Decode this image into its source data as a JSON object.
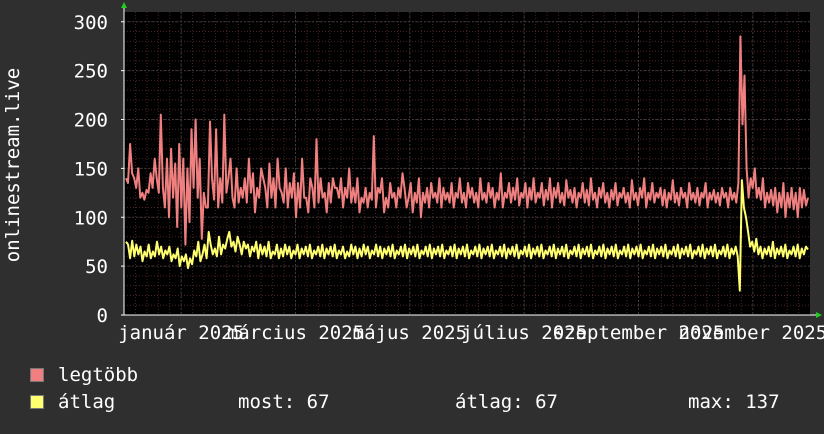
{
  "colors": {
    "background": "#2f2f2f",
    "plot_background": "#000000",
    "grid": "#3a3a3a",
    "grid_minor": "#4a2222",
    "axis": "#ffffff",
    "arrow": "#22cc22",
    "legtobb": "#f08080",
    "atlag": "#ffff70"
  },
  "legend": {
    "legtobb_label": "legtöbb",
    "atlag_label": "átlag",
    "stats": {
      "most_label": "most:",
      "most_value": "67",
      "atlag_label": "átlag:",
      "atlag_value": "67",
      "max_label": "max:",
      "max_value": "137"
    }
  },
  "chart_data": {
    "type": "line",
    "ylabel": "onlinestream.live",
    "ylim": [
      0,
      310
    ],
    "yticks": [
      0,
      50,
      100,
      150,
      200,
      250,
      300
    ],
    "x_tick_labels": [
      "január 2025",
      "március 2025",
      "május 2025",
      "július 2025",
      "szeptember 2025",
      "november 2025"
    ],
    "grid": true,
    "series": [
      {
        "name": "legtöbb",
        "color": "#f08080",
        "values": [
          140,
          135,
          175,
          145,
          140,
          130,
          150,
          120,
          125,
          118,
          128,
          125,
          145,
          130,
          160,
          140,
          125,
          205,
          130,
          110,
          160,
          100,
          170,
          120,
          155,
          90,
          175,
          110,
          160,
          72,
          150,
          95,
          190,
          130,
          200,
          120,
          160,
          78,
          125,
          110,
          110,
          198,
          140,
          118,
          190,
          110,
          140,
          115,
          205,
          125,
          140,
          160,
          120,
          110,
          150,
          115,
          130,
          120,
          140,
          115,
          160,
          125,
          145,
          105,
          130,
          120,
          150,
          140,
          130,
          110,
          155,
          120,
          140,
          110,
          160,
          130,
          125,
          115,
          150,
          110,
          135,
          120,
          145,
          100,
          135,
          110,
          160,
          120,
          120,
          105,
          140,
          130,
          110,
          180,
          115,
          140,
          120,
          125,
          105,
          135,
          115,
          140,
          130,
          130,
          120,
          140,
          110,
          130,
          120,
          150,
          115,
          130,
          115,
          140,
          105,
          120,
          115,
          130,
          110,
          125,
          118,
          183,
          110,
          130,
          125,
          140,
          105,
          120,
          110,
          135,
          120,
          125,
          110,
          130,
          120,
          145,
          130,
          110,
          120,
          135,
          105,
          125,
          115,
          140,
          100,
          125,
          115,
          130,
          110,
          135,
          120,
          125,
          115,
          140,
          110,
          130,
          118,
          125,
          115,
          135,
          110,
          125,
          120,
          140,
          115,
          125,
          110,
          135,
          120,
          130,
          115,
          125,
          110,
          140,
          118,
          125,
          115,
          135,
          120,
          130,
          110,
          125,
          118,
          145,
          110,
          125,
          120,
          135,
          115,
          130,
          118,
          140,
          112,
          125,
          120,
          135,
          110,
          130,
          118,
          140,
          115,
          125,
          120,
          135,
          112,
          128,
          118,
          140,
          110,
          130,
          120,
          135,
          115,
          125,
          112,
          138,
          120,
          128,
          115,
          130,
          110,
          125,
          120,
          135,
          115,
          128,
          112,
          140,
          118,
          125,
          110,
          130,
          120,
          135,
          115,
          125,
          110,
          128,
          118,
          135,
          112,
          125,
          120,
          130,
          115,
          125,
          110,
          138,
          118,
          125,
          112,
          130,
          120,
          140,
          110,
          125,
          118,
          135,
          115,
          125,
          120,
          130,
          112,
          128,
          110,
          125,
          118,
          138,
          115,
          125,
          112,
          130,
          120,
          125,
          110,
          135,
          118,
          125,
          115,
          130,
          112,
          125,
          120,
          135,
          110,
          125,
          118,
          128,
          115,
          125,
          112,
          130,
          120,
          125,
          110,
          130,
          118,
          125,
          115,
          135,
          285,
          195,
          245,
          150,
          120,
          140,
          130,
          150,
          120,
          130,
          118,
          140,
          110,
          125,
          115,
          128,
          112,
          130,
          105,
          125,
          110,
          135,
          100,
          125,
          110,
          130,
          108,
          125,
          100,
          130,
          110,
          128,
          112,
          120
        ]
      },
      {
        "name": "átlag",
        "color": "#ffff70",
        "values": [
          75,
          72,
          58,
          76,
          60,
          72,
          62,
          70,
          55,
          65,
          60,
          72,
          58,
          65,
          60,
          75,
          62,
          70,
          58,
          66,
          62,
          70,
          55,
          62,
          58,
          68,
          50,
          60,
          55,
          62,
          48,
          58,
          52,
          66,
          60,
          75,
          55,
          62,
          72,
          58,
          85,
          72,
          62,
          68,
          60,
          80,
          62,
          72,
          68,
          78,
          85,
          70,
          75,
          65,
          80,
          72,
          62,
          75,
          68,
          72,
          60,
          70,
          65,
          75,
          58,
          72,
          62,
          70,
          60,
          75,
          58,
          65,
          62,
          72,
          58,
          68,
          60,
          72,
          62,
          70,
          58,
          66,
          62,
          72,
          58,
          68,
          62,
          70,
          60,
          72,
          58,
          66,
          62,
          70,
          60,
          72,
          58,
          68,
          62,
          70,
          60,
          72,
          58,
          66,
          62,
          70,
          58,
          65,
          60,
          72,
          62,
          70,
          58,
          68,
          60,
          72,
          62,
          70,
          58,
          66,
          62,
          72,
          60,
          70,
          58,
          68,
          62,
          70,
          60,
          72,
          58,
          66,
          62,
          70,
          60,
          72,
          58,
          68,
          62,
          70,
          60,
          72,
          58,
          66,
          62,
          70,
          60,
          72,
          58,
          68,
          62,
          70,
          60,
          72,
          58,
          66,
          62,
          70,
          60,
          72,
          58,
          68,
          62,
          70,
          60,
          72,
          58,
          66,
          62,
          70,
          60,
          72,
          58,
          68,
          62,
          70,
          60,
          72,
          58,
          66,
          62,
          70,
          60,
          72,
          58,
          68,
          62,
          70,
          60,
          72,
          58,
          66,
          62,
          70,
          60,
          72,
          58,
          68,
          62,
          70,
          60,
          72,
          58,
          66,
          62,
          70,
          60,
          72,
          58,
          68,
          62,
          70,
          60,
          72,
          58,
          66,
          62,
          70,
          60,
          72,
          58,
          68,
          62,
          70,
          60,
          72,
          58,
          66,
          62,
          70,
          60,
          72,
          58,
          68,
          62,
          70,
          60,
          72,
          58,
          66,
          62,
          70,
          60,
          72,
          58,
          68,
          62,
          70,
          60,
          72,
          58,
          66,
          62,
          70,
          60,
          72,
          58,
          68,
          62,
          70,
          60,
          72,
          58,
          66,
          62,
          70,
          60,
          72,
          58,
          68,
          62,
          70,
          60,
          72,
          58,
          66,
          62,
          70,
          60,
          72,
          58,
          68,
          62,
          70,
          60,
          72,
          58,
          66,
          62,
          70,
          60,
          72,
          58,
          68,
          62,
          70,
          60,
          25,
          138,
          110,
          100,
          85,
          70,
          75,
          65,
          78,
          62,
          70,
          58,
          68,
          62,
          70,
          60,
          75,
          58,
          68,
          62,
          70,
          60,
          72,
          58,
          66,
          62,
          70,
          60,
          72,
          58,
          68,
          62,
          70,
          67
        ]
      }
    ]
  }
}
